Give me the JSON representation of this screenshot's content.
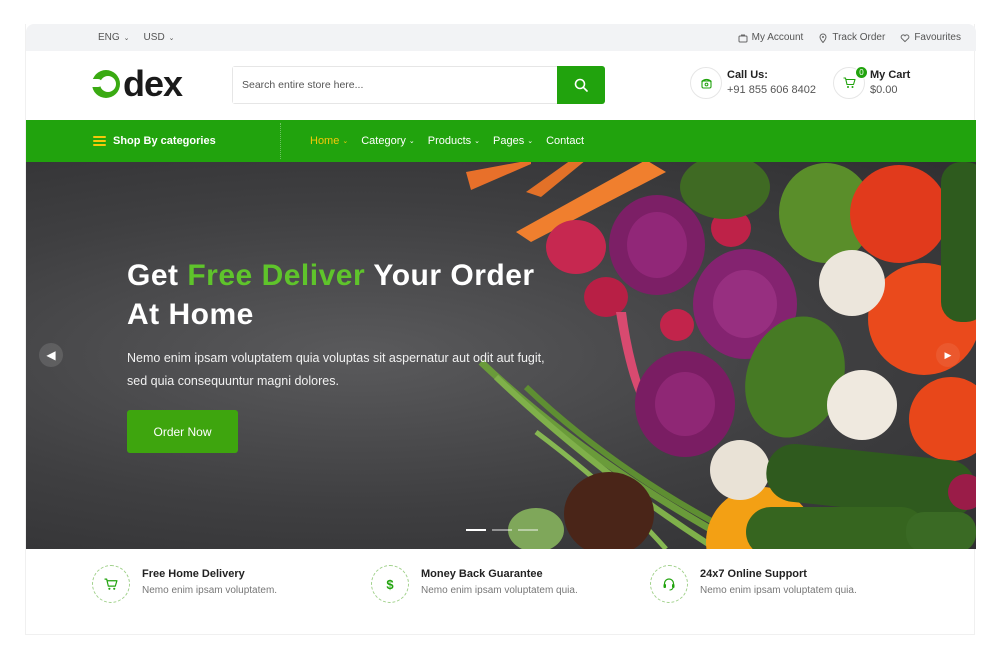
{
  "topbar": {
    "language": "ENG",
    "currency": "USD",
    "my_account": "My Account",
    "track_order": "Track Order",
    "favourites": "Favourites"
  },
  "header": {
    "logo_text": "dex",
    "search_placeholder": "Search entire store here...",
    "call_title": "Call Us:",
    "call_number": "+91 855 606 8402",
    "cart_title": "My Cart",
    "cart_total": "$0.00",
    "cart_count": "0"
  },
  "nav": {
    "categories_label": "Shop By categories",
    "items": [
      {
        "label": "Home",
        "active": true,
        "dropdown": true
      },
      {
        "label": "Category",
        "active": false,
        "dropdown": true
      },
      {
        "label": "Products",
        "active": false,
        "dropdown": true
      },
      {
        "label": "Pages",
        "active": false,
        "dropdown": true
      },
      {
        "label": "Contact",
        "active": false,
        "dropdown": false
      }
    ]
  },
  "hero": {
    "title_part1": "Get ",
    "title_highlight": "Free Deliver",
    "title_part2": " Your Order",
    "title_line2": "At Home",
    "subtitle_line1": "Nemo enim ipsam voluptatem quia voluptas sit aspernatur aut odit aut fugit,",
    "subtitle_line2": "sed quia consequuntur magni dolores.",
    "button_label": "Order Now",
    "slide_count": 3,
    "active_slide": 1
  },
  "features": [
    {
      "title": "Free Home Delivery",
      "desc": "Nemo enim ipsam voluptatem.",
      "icon": "cart-icon"
    },
    {
      "title": "Money Back Guarantee",
      "desc": "Nemo enim ipsam voluptatem quia.",
      "icon": "dollar-icon"
    },
    {
      "title": "24x7 Online Support",
      "desc": "Nemo enim ipsam voluptatem quia.",
      "icon": "headset-icon"
    }
  ],
  "colors": {
    "brand_green": "#21a30d",
    "highlight_green": "#5fc42b",
    "nav_active": "#f5c80a",
    "hero_bg": "#3f3f41"
  }
}
